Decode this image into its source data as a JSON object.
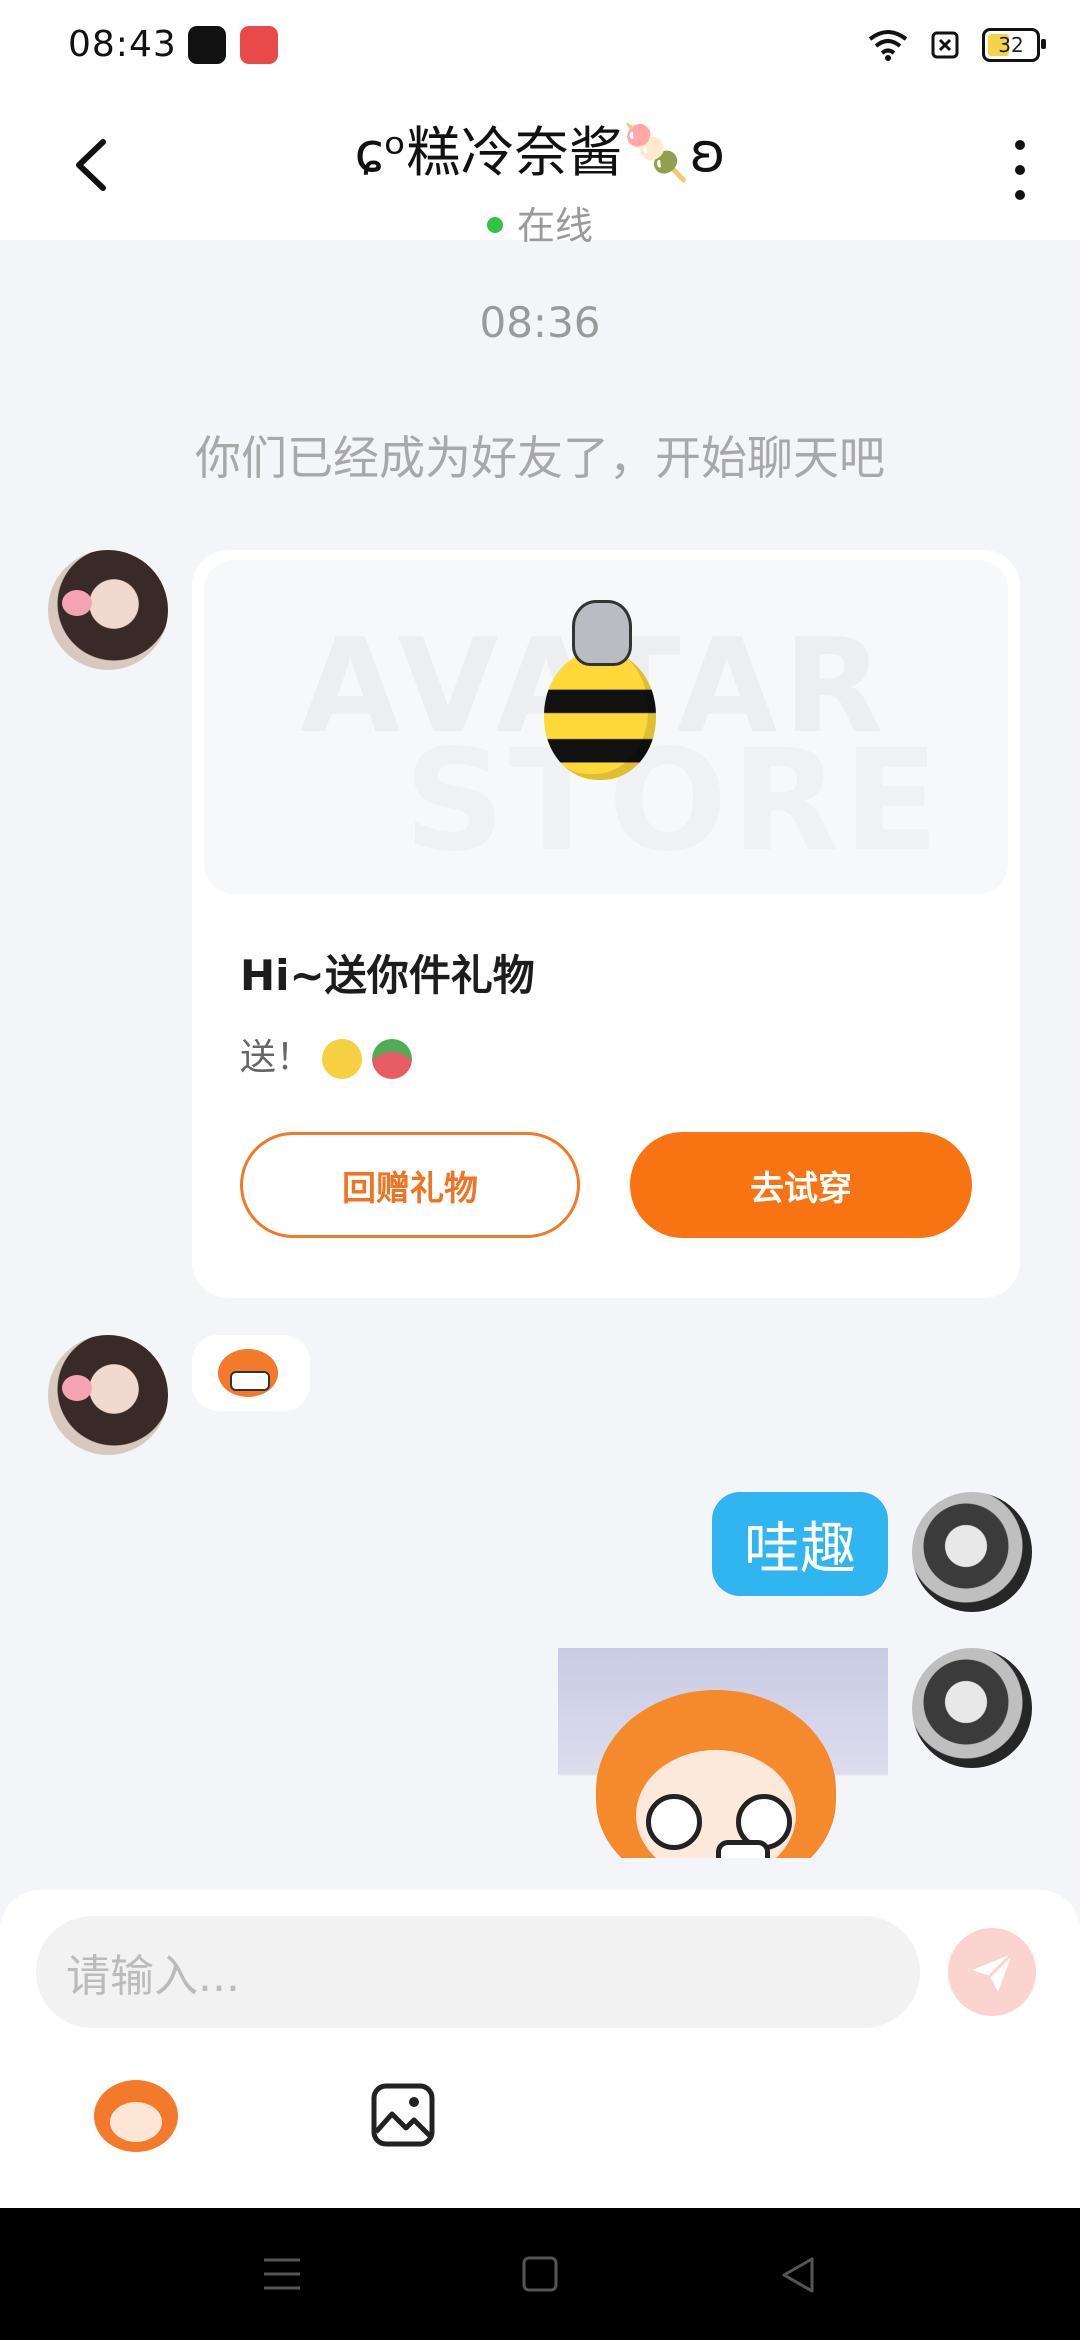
{
  "status_bar": {
    "time": "08:43",
    "battery": "32"
  },
  "header": {
    "title": "ɕᵒ糕冷奈酱🍡ʚ",
    "status": "在线"
  },
  "chat": {
    "timestamp": "08:36",
    "system_message": "你们已经成为好友了，开始聊天吧",
    "gift_card": {
      "watermark_line1": "AVATAR",
      "watermark_line2": "STORE",
      "title": "Hi~送你件礼物",
      "subtitle": "送！",
      "return_button": "回赠礼物",
      "try_button": "去试穿"
    },
    "my_message": "哇趣"
  },
  "composer": {
    "placeholder": "请输入..."
  },
  "icons": [
    "back-icon",
    "more-icon",
    "send-icon",
    "sticker-icon",
    "image-icon",
    "menu-icon",
    "home-icon",
    "back-nav-icon"
  ]
}
